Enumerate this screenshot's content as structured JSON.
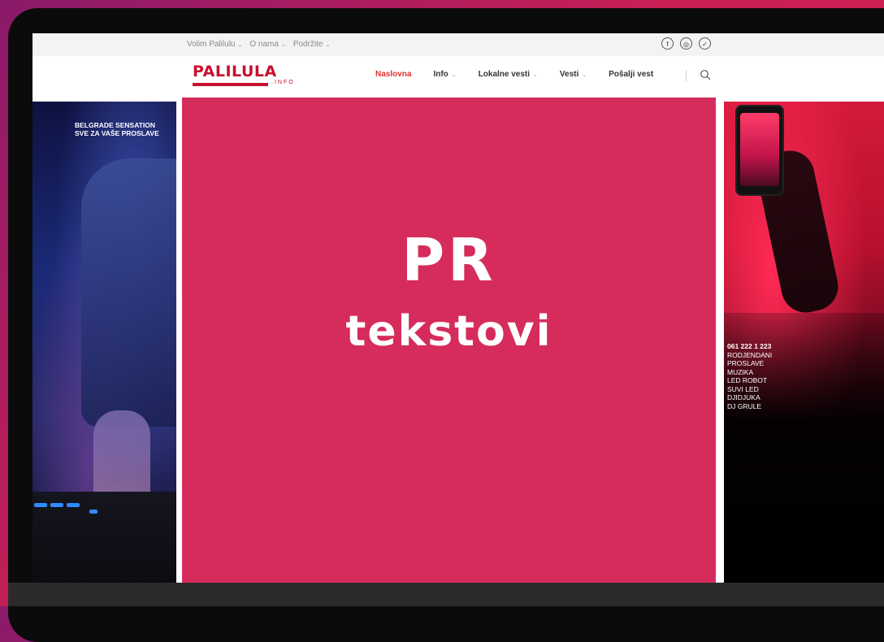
{
  "topbar": {
    "menu": [
      {
        "label": "Volim Palilulu",
        "caret": "⌄"
      },
      {
        "label": "O nama",
        "caret": "⌄"
      },
      {
        "label": "Podržite",
        "caret": "⌄"
      }
    ],
    "social": [
      {
        "name": "facebook",
        "glyph": "f"
      },
      {
        "name": "instagram",
        "glyph": "◎"
      },
      {
        "name": "twitter",
        "glyph": "✓"
      }
    ]
  },
  "header": {
    "logo": {
      "text": "PALILULA",
      "sub": ".INFO"
    },
    "nav": [
      {
        "label": "Naslovna",
        "active": true,
        "caret": ""
      },
      {
        "label": "Info",
        "active": false,
        "caret": "⌄"
      },
      {
        "label": "Lokalne vesti",
        "active": false,
        "caret": "⌄"
      },
      {
        "label": "Vesti",
        "active": false,
        "caret": "⌄"
      },
      {
        "label": "Pošalji vest",
        "active": false,
        "caret": ""
      }
    ]
  },
  "left_ad": {
    "line1": "BELGRADE SENSATION",
    "line2": "SVE ZA VAŠE PROSLAVE"
  },
  "right_ad": {
    "phone": "061 222 1 223",
    "lines": [
      "RODJENDANI",
      "PROSLAVE",
      "MUZIKA",
      "LED ROBOT",
      "SUVI LED",
      "DJIDJUKA",
      "DJ GRULE"
    ]
  },
  "center": {
    "title": "PR",
    "subtitle": "tekstovi"
  },
  "colors": {
    "brand": "#c8102e",
    "nav_active": "#e0312d",
    "center_block": "#d62c5c"
  }
}
